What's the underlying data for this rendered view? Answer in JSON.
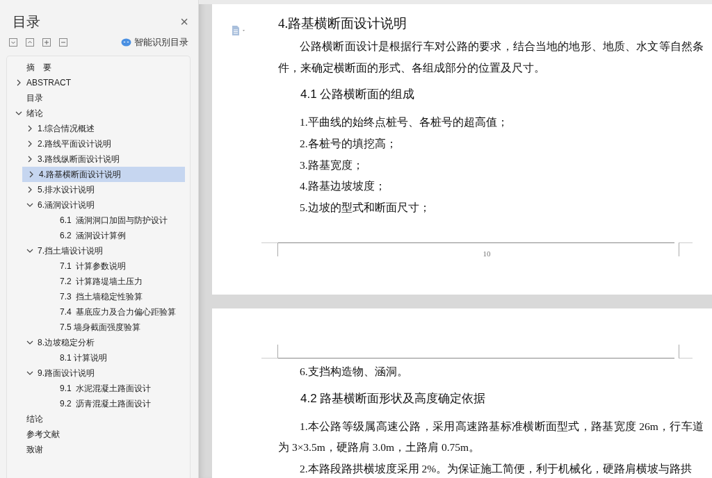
{
  "sidebar": {
    "title": "目录",
    "close": "×",
    "smart_button": "智能识别目录",
    "items": [
      {
        "label": "摘　要",
        "kind": "leaf",
        "selected": false
      },
      {
        "label": "ABSTRACT",
        "kind": "branch",
        "expanded": false,
        "selected": false
      },
      {
        "label": "目录",
        "kind": "leaf",
        "selected": false
      },
      {
        "label": "绪论",
        "kind": "branch",
        "expanded": true,
        "selected": false,
        "children": [
          {
            "label": "1.综合情况概述",
            "kind": "branch",
            "expanded": false,
            "selected": false
          },
          {
            "label": "2.路线平面设计说明",
            "kind": "branch",
            "expanded": false,
            "selected": false
          },
          {
            "label": "3.路线纵断面设计说明",
            "kind": "branch",
            "expanded": false,
            "selected": false
          },
          {
            "label": "4.路基横断面设计说明",
            "kind": "branch",
            "expanded": false,
            "selected": true
          },
          {
            "label": "5.排水设计说明",
            "kind": "branch",
            "expanded": false,
            "selected": false
          },
          {
            "label": "6.涵洞设计说明",
            "kind": "branch",
            "expanded": true,
            "selected": false,
            "children": [
              {
                "label": "6.1  涵洞洞口加固与防护设计",
                "kind": "leaf",
                "selected": false
              },
              {
                "label": "6.2  涵洞设计算例",
                "kind": "leaf",
                "selected": false
              }
            ]
          },
          {
            "label": "7.挡土墙设计说明",
            "kind": "branch",
            "expanded": true,
            "selected": false,
            "children": [
              {
                "label": "7.1  计算参数说明",
                "kind": "leaf",
                "selected": false
              },
              {
                "label": "7.2  计算路堤墙土压力",
                "kind": "leaf",
                "selected": false
              },
              {
                "label": "7.3  挡土墙稳定性验算",
                "kind": "leaf",
                "selected": false
              },
              {
                "label": "7.4  基底应力及合力偏心距验算",
                "kind": "leaf",
                "selected": false
              },
              {
                "label": "7.5 墙身截面强度验算",
                "kind": "leaf",
                "selected": false
              }
            ]
          },
          {
            "label": "8.边坡稳定分析",
            "kind": "branch",
            "expanded": true,
            "selected": false,
            "children": [
              {
                "label": "8.1 计算说明",
                "kind": "leaf",
                "selected": false
              }
            ]
          },
          {
            "label": "9.路面设计说明",
            "kind": "branch",
            "expanded": true,
            "selected": false,
            "children": [
              {
                "label": "9.1  水泥混凝土路面设计",
                "kind": "leaf",
                "selected": false
              },
              {
                "label": "9.2  沥青混凝土路面设计",
                "kind": "leaf",
                "selected": false
              }
            ]
          }
        ]
      },
      {
        "label": "结论",
        "kind": "leaf",
        "selected": false
      },
      {
        "label": "参考文献",
        "kind": "leaf",
        "selected": false
      },
      {
        "label": "致谢",
        "kind": "leaf",
        "selected": false
      }
    ]
  },
  "pages": [
    {
      "page_number": "10",
      "blocks": [
        {
          "kind": "heading1",
          "text": "4.路基横断面设计说明"
        },
        {
          "kind": "paragraph",
          "text": "公路横断面设计是根据行车对公路的要求，结合当地的地形、地质、水文等自然条件，来确定横断面的形式、各组成部分的位置及尺寸。"
        },
        {
          "kind": "heading2",
          "text": "4.1  公路横断面的组成"
        },
        {
          "kind": "list_item",
          "text": "1.平曲线的始终点桩号、各桩号的超高值；"
        },
        {
          "kind": "list_item",
          "text": "2.各桩号的填挖高；"
        },
        {
          "kind": "list_item",
          "text": "3.路基宽度；"
        },
        {
          "kind": "list_item",
          "text": "4.路基边坡坡度；"
        },
        {
          "kind": "list_item",
          "text": "5.边坡的型式和断面尺寸；"
        }
      ]
    },
    {
      "blocks": [
        {
          "kind": "list_item",
          "text": "6.支挡构造物、涵洞。"
        },
        {
          "kind": "heading2",
          "text": "4.2  路基横断面形状及高度确定依据"
        },
        {
          "kind": "paragraph",
          "text": "1.本公路等级属高速公路，采用高速路基标准横断面型式，路基宽度 26m，行车道为 3×3.5m，硬路肩 3.0m，土路肩 0.75m。"
        },
        {
          "kind": "paragraph",
          "text": "2.本路段路拱横坡度采用 2%。为保证施工简便，利于机械化，硬路肩横坡与路拱"
        }
      ]
    }
  ]
}
